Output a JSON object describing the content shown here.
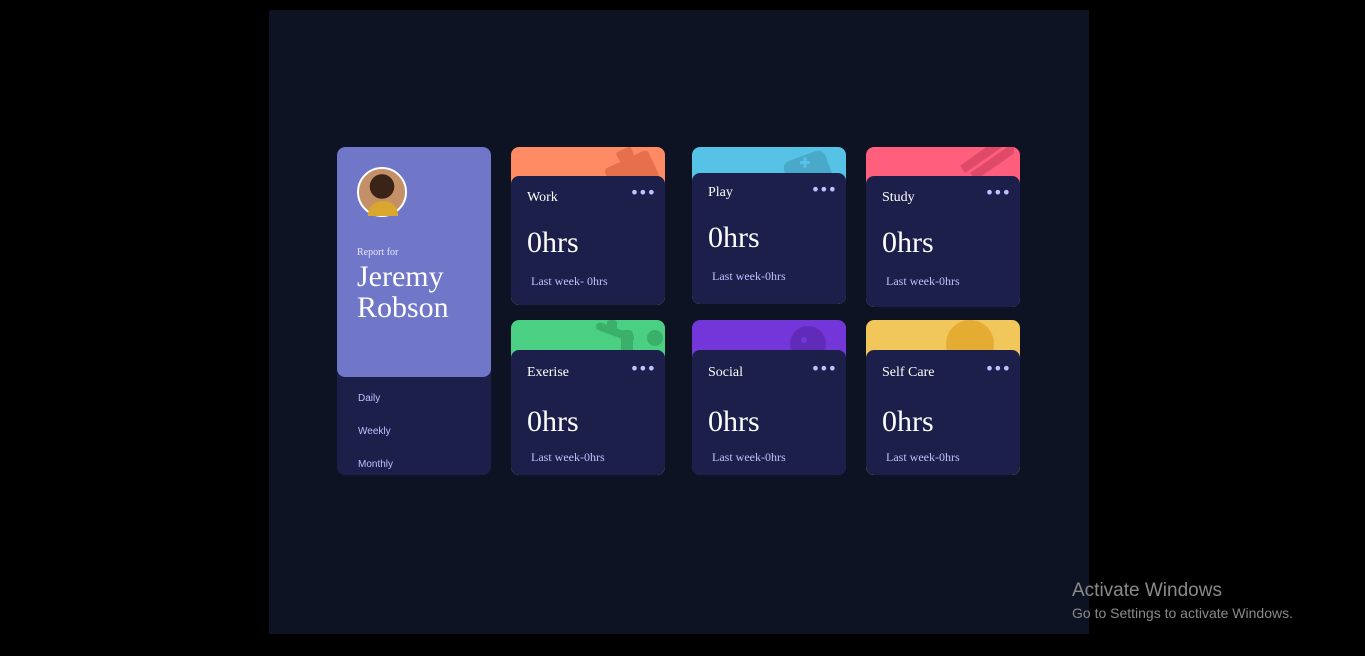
{
  "profile": {
    "report_for": "Report for",
    "name": "Jeremy Robson",
    "periods": [
      "Daily",
      "Weekly",
      "Monthly"
    ]
  },
  "activities": [
    {
      "title": "Work",
      "hours": "0hrs",
      "last_week": "Last week- 0hrs",
      "color": "#ff8b64",
      "icon": "briefcase-icon"
    },
    {
      "title": "Play",
      "hours": "0hrs",
      "last_week": "Last week-0hrs",
      "color": "#55c2e6",
      "icon": "gamepad-icon"
    },
    {
      "title": "Study",
      "hours": "0hrs",
      "last_week": "Last week-0hrs",
      "color": "#ff5e7d",
      "icon": "pencil-icon"
    },
    {
      "title": "Exerise",
      "hours": "0hrs",
      "last_week": "Last week-0hrs",
      "color": "#4bcf82",
      "icon": "runner-icon"
    },
    {
      "title": "Social",
      "hours": "0hrs",
      "last_week": "Last week-0hrs",
      "color": "#7336d9",
      "icon": "chat-icon"
    },
    {
      "title": "Self Care",
      "hours": "0hrs",
      "last_week": "Last week-0hrs",
      "color": "#f1c65b",
      "icon": "smiley-icon"
    }
  ],
  "dots": "•••",
  "watermark": {
    "title": "Activate Windows",
    "subtitle": "Go to Settings to activate Windows."
  }
}
